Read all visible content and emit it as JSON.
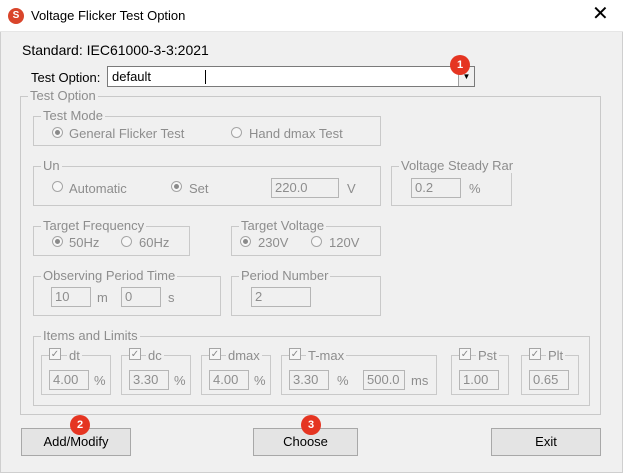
{
  "window": {
    "title": "Voltage Flicker Test Option",
    "close_glyph": "✕",
    "icon": "app-logo-icon",
    "icon_glyph": "S"
  },
  "standard": {
    "text": "Standard: IEC61000-3-3:2021"
  },
  "test_option_select": {
    "label": "Test Option:",
    "value": "default",
    "arrow": "▼"
  },
  "test_option_group": {
    "title": "Test Option",
    "test_mode": {
      "title": "Test Mode",
      "options": [
        {
          "label": "General Flicker Test",
          "selected": true
        },
        {
          "label": "Hand dmax Test",
          "selected": false
        }
      ]
    },
    "un": {
      "title": "Un",
      "options": [
        {
          "label": "Automatic",
          "selected": false
        },
        {
          "label": "Set",
          "selected": true
        }
      ],
      "value": "220.0",
      "unit": "V"
    },
    "voltage_steady": {
      "title": "Voltage Steady Rar",
      "value": "0.2",
      "unit": "%"
    },
    "target_frequency": {
      "title": "Target Frequency",
      "options": [
        {
          "label": "50Hz",
          "selected": true
        },
        {
          "label": "60Hz",
          "selected": false
        }
      ]
    },
    "target_voltage": {
      "title": "Target Voltage",
      "options": [
        {
          "label": "230V",
          "selected": true
        },
        {
          "label": "120V",
          "selected": false
        }
      ]
    },
    "observing_period": {
      "title": "Observing Period Time",
      "minutes": "10",
      "minutes_unit": "m",
      "seconds": "0",
      "seconds_unit": "s"
    },
    "period_number": {
      "title": "Period Number",
      "value": "2"
    },
    "items_limits": {
      "title": "Items and Limits",
      "check_glyph": "✓",
      "items": [
        {
          "label": "dt",
          "checked": true,
          "value": "4.00",
          "unit": "%"
        },
        {
          "label": "dc",
          "checked": true,
          "value": "3.30",
          "unit": "%"
        },
        {
          "label": "dmax",
          "checked": true,
          "value": "4.00",
          "unit": "%"
        },
        {
          "label": "T-max",
          "checked": true,
          "value": "3.30",
          "unit": "%",
          "value2": "500.0",
          "unit2": "ms"
        },
        {
          "label": "Pst",
          "checked": true,
          "value": "1.00"
        },
        {
          "label": "Plt",
          "checked": true,
          "value": "0.65"
        }
      ]
    }
  },
  "buttons": {
    "add_modify": "Add/Modify",
    "choose": "Choose",
    "exit": "Exit"
  },
  "badges": [
    "1",
    "2",
    "3"
  ],
  "colors": {
    "badge": "#e53522",
    "app_icon": "#d9452b",
    "disabled_text": "#8d8d8d"
  }
}
